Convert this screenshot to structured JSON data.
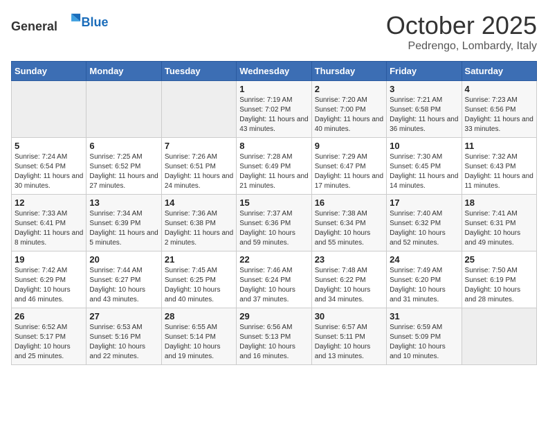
{
  "header": {
    "logo_general": "General",
    "logo_blue": "Blue",
    "month": "October 2025",
    "location": "Pedrengo, Lombardy, Italy"
  },
  "weekdays": [
    "Sunday",
    "Monday",
    "Tuesday",
    "Wednesday",
    "Thursday",
    "Friday",
    "Saturday"
  ],
  "weeks": [
    [
      {
        "day": "",
        "sunrise": "",
        "sunset": "",
        "daylight": ""
      },
      {
        "day": "",
        "sunrise": "",
        "sunset": "",
        "daylight": ""
      },
      {
        "day": "",
        "sunrise": "",
        "sunset": "",
        "daylight": ""
      },
      {
        "day": "1",
        "sunrise": "Sunrise: 7:19 AM",
        "sunset": "Sunset: 7:02 PM",
        "daylight": "Daylight: 11 hours and 43 minutes."
      },
      {
        "day": "2",
        "sunrise": "Sunrise: 7:20 AM",
        "sunset": "Sunset: 7:00 PM",
        "daylight": "Daylight: 11 hours and 40 minutes."
      },
      {
        "day": "3",
        "sunrise": "Sunrise: 7:21 AM",
        "sunset": "Sunset: 6:58 PM",
        "daylight": "Daylight: 11 hours and 36 minutes."
      },
      {
        "day": "4",
        "sunrise": "Sunrise: 7:23 AM",
        "sunset": "Sunset: 6:56 PM",
        "daylight": "Daylight: 11 hours and 33 minutes."
      }
    ],
    [
      {
        "day": "5",
        "sunrise": "Sunrise: 7:24 AM",
        "sunset": "Sunset: 6:54 PM",
        "daylight": "Daylight: 11 hours and 30 minutes."
      },
      {
        "day": "6",
        "sunrise": "Sunrise: 7:25 AM",
        "sunset": "Sunset: 6:52 PM",
        "daylight": "Daylight: 11 hours and 27 minutes."
      },
      {
        "day": "7",
        "sunrise": "Sunrise: 7:26 AM",
        "sunset": "Sunset: 6:51 PM",
        "daylight": "Daylight: 11 hours and 24 minutes."
      },
      {
        "day": "8",
        "sunrise": "Sunrise: 7:28 AM",
        "sunset": "Sunset: 6:49 PM",
        "daylight": "Daylight: 11 hours and 21 minutes."
      },
      {
        "day": "9",
        "sunrise": "Sunrise: 7:29 AM",
        "sunset": "Sunset: 6:47 PM",
        "daylight": "Daylight: 11 hours and 17 minutes."
      },
      {
        "day": "10",
        "sunrise": "Sunrise: 7:30 AM",
        "sunset": "Sunset: 6:45 PM",
        "daylight": "Daylight: 11 hours and 14 minutes."
      },
      {
        "day": "11",
        "sunrise": "Sunrise: 7:32 AM",
        "sunset": "Sunset: 6:43 PM",
        "daylight": "Daylight: 11 hours and 11 minutes."
      }
    ],
    [
      {
        "day": "12",
        "sunrise": "Sunrise: 7:33 AM",
        "sunset": "Sunset: 6:41 PM",
        "daylight": "Daylight: 11 hours and 8 minutes."
      },
      {
        "day": "13",
        "sunrise": "Sunrise: 7:34 AM",
        "sunset": "Sunset: 6:39 PM",
        "daylight": "Daylight: 11 hours and 5 minutes."
      },
      {
        "day": "14",
        "sunrise": "Sunrise: 7:36 AM",
        "sunset": "Sunset: 6:38 PM",
        "daylight": "Daylight: 11 hours and 2 minutes."
      },
      {
        "day": "15",
        "sunrise": "Sunrise: 7:37 AM",
        "sunset": "Sunset: 6:36 PM",
        "daylight": "Daylight: 10 hours and 59 minutes."
      },
      {
        "day": "16",
        "sunrise": "Sunrise: 7:38 AM",
        "sunset": "Sunset: 6:34 PM",
        "daylight": "Daylight: 10 hours and 55 minutes."
      },
      {
        "day": "17",
        "sunrise": "Sunrise: 7:40 AM",
        "sunset": "Sunset: 6:32 PM",
        "daylight": "Daylight: 10 hours and 52 minutes."
      },
      {
        "day": "18",
        "sunrise": "Sunrise: 7:41 AM",
        "sunset": "Sunset: 6:31 PM",
        "daylight": "Daylight: 10 hours and 49 minutes."
      }
    ],
    [
      {
        "day": "19",
        "sunrise": "Sunrise: 7:42 AM",
        "sunset": "Sunset: 6:29 PM",
        "daylight": "Daylight: 10 hours and 46 minutes."
      },
      {
        "day": "20",
        "sunrise": "Sunrise: 7:44 AM",
        "sunset": "Sunset: 6:27 PM",
        "daylight": "Daylight: 10 hours and 43 minutes."
      },
      {
        "day": "21",
        "sunrise": "Sunrise: 7:45 AM",
        "sunset": "Sunset: 6:25 PM",
        "daylight": "Daylight: 10 hours and 40 minutes."
      },
      {
        "day": "22",
        "sunrise": "Sunrise: 7:46 AM",
        "sunset": "Sunset: 6:24 PM",
        "daylight": "Daylight: 10 hours and 37 minutes."
      },
      {
        "day": "23",
        "sunrise": "Sunrise: 7:48 AM",
        "sunset": "Sunset: 6:22 PM",
        "daylight": "Daylight: 10 hours and 34 minutes."
      },
      {
        "day": "24",
        "sunrise": "Sunrise: 7:49 AM",
        "sunset": "Sunset: 6:20 PM",
        "daylight": "Daylight: 10 hours and 31 minutes."
      },
      {
        "day": "25",
        "sunrise": "Sunrise: 7:50 AM",
        "sunset": "Sunset: 6:19 PM",
        "daylight": "Daylight: 10 hours and 28 minutes."
      }
    ],
    [
      {
        "day": "26",
        "sunrise": "Sunrise: 6:52 AM",
        "sunset": "Sunset: 5:17 PM",
        "daylight": "Daylight: 10 hours and 25 minutes."
      },
      {
        "day": "27",
        "sunrise": "Sunrise: 6:53 AM",
        "sunset": "Sunset: 5:16 PM",
        "daylight": "Daylight: 10 hours and 22 minutes."
      },
      {
        "day": "28",
        "sunrise": "Sunrise: 6:55 AM",
        "sunset": "Sunset: 5:14 PM",
        "daylight": "Daylight: 10 hours and 19 minutes."
      },
      {
        "day": "29",
        "sunrise": "Sunrise: 6:56 AM",
        "sunset": "Sunset: 5:13 PM",
        "daylight": "Daylight: 10 hours and 16 minutes."
      },
      {
        "day": "30",
        "sunrise": "Sunrise: 6:57 AM",
        "sunset": "Sunset: 5:11 PM",
        "daylight": "Daylight: 10 hours and 13 minutes."
      },
      {
        "day": "31",
        "sunrise": "Sunrise: 6:59 AM",
        "sunset": "Sunset: 5:09 PM",
        "daylight": "Daylight: 10 hours and 10 minutes."
      },
      {
        "day": "",
        "sunrise": "",
        "sunset": "",
        "daylight": ""
      }
    ]
  ]
}
